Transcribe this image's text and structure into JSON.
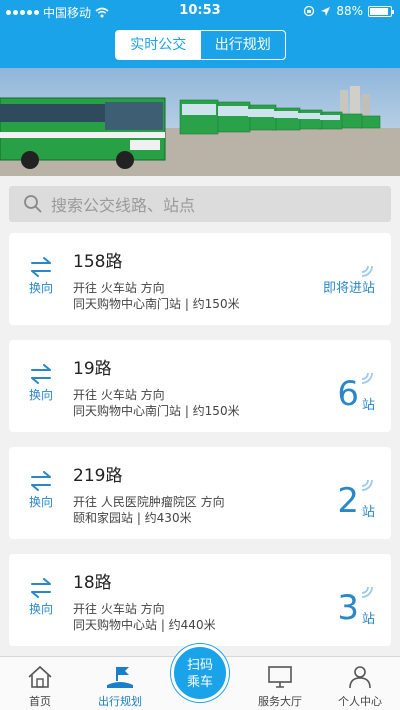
{
  "status_bar": {
    "carrier": "中国移动",
    "time": "10:53",
    "battery": "88%"
  },
  "segmented": {
    "realtime": "实时公交",
    "plan": "出行规划"
  },
  "search": {
    "placeholder": "搜索公交线路、站点"
  },
  "cards": [
    {
      "route": "158路",
      "swap_label": "换向",
      "direction": "开往 火车站 方向",
      "stop_info": "同天购物中心南门站 | 约150米",
      "eta_text": "即将进站"
    },
    {
      "route": "19路",
      "swap_label": "换向",
      "direction": "开往 火车站 方向",
      "stop_info": "同天购物中心南门站 | 约150米",
      "eta_num": "6",
      "eta_unit": "站"
    },
    {
      "route": "219路",
      "swap_label": "换向",
      "direction": "开往 人民医院肿瘤院区 方向",
      "stop_info": "颐和家园站 | 约430米",
      "eta_num": "2",
      "eta_unit": "站"
    },
    {
      "route": "18路",
      "swap_label": "换向",
      "direction": "开往 火车站 方向",
      "stop_info": "同天购物中心站 | 约440米",
      "eta_num": "3",
      "eta_unit": "站"
    }
  ],
  "tabbar": {
    "home": "首页",
    "plan": "出行规划",
    "scan_line1": "扫码",
    "scan_line2": "乘车",
    "service": "服务大厅",
    "profile": "个人中心"
  },
  "icons": {
    "search": "search-icon",
    "swap": "swap-arrows-icon",
    "signal": "signal-wave-icon",
    "home": "home-icon",
    "plan": "flag-route-icon",
    "service": "monitor-icon",
    "profile": "person-icon"
  },
  "colors": {
    "primary": "#1aa3e8",
    "accent": "#2a87c8"
  }
}
